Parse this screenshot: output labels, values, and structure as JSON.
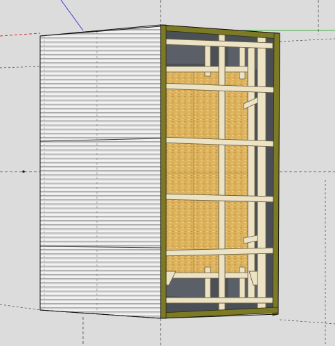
{
  "viewport": {
    "background": "#dcdcdc"
  },
  "colors": {
    "metal_light": "#e6e6e6",
    "metal_dark": "#8e8e8e",
    "osb": "#dcb25c",
    "osb_light": "#ecc874",
    "lumber": "#ece2c4",
    "lumber_edge": "#6d6248",
    "trim_green": "#7d7a26",
    "interior_dark": "#4b4f56",
    "axis_red": "#d43030",
    "axis_green": "#3fb03f",
    "axis_blue": "#3a3ad4"
  }
}
